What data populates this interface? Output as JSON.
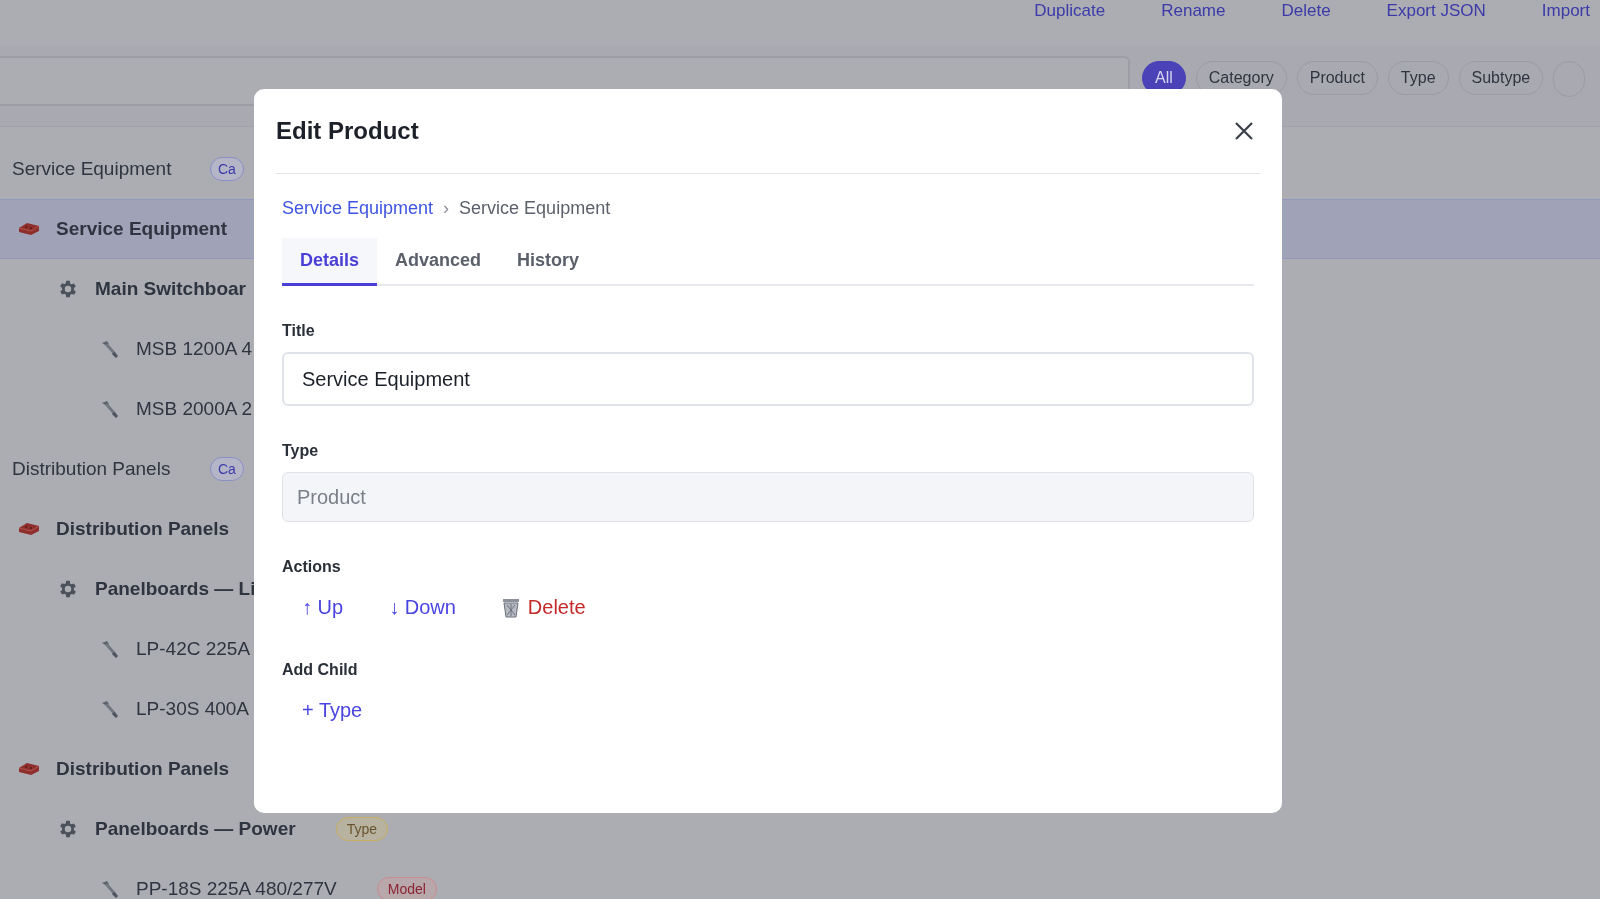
{
  "toolbar": {
    "actions": [
      "Duplicate",
      "Rename",
      "Delete",
      "Export JSON",
      "Import"
    ]
  },
  "filters": [
    {
      "label": "All",
      "selected": true
    },
    {
      "label": "Category",
      "selected": false
    },
    {
      "label": "Product",
      "selected": false
    },
    {
      "label": "Type",
      "selected": false
    },
    {
      "label": "Subtype",
      "selected": false
    }
  ],
  "tree": [
    {
      "title": "Service Equipment",
      "badge": {
        "label": "Ca",
        "kind": "category"
      },
      "items": [
        {
          "kind": "product",
          "label": "Service Equipment",
          "selected": true,
          "children": [
            {
              "kind": "type",
              "label": "Main Switchboar",
              "selected": false,
              "children": [
                {
                  "kind": "model",
                  "label": "MSB 1200A 4",
                  "selected": false
                },
                {
                  "kind": "model",
                  "label": "MSB 2000A 2",
                  "selected": false
                }
              ]
            }
          ]
        }
      ]
    },
    {
      "title": "Distribution Panels",
      "badge": {
        "label": "Ca",
        "kind": "category"
      },
      "items": [
        {
          "kind": "product",
          "label": "Distribution Panels",
          "selected": false,
          "children": [
            {
              "kind": "type",
              "label": "Panelboards — Li",
              "selected": false,
              "children": [
                {
                  "kind": "model",
                  "label": "LP-42C 225A",
                  "selected": false
                },
                {
                  "kind": "model",
                  "label": "LP-30S 400A",
                  "selected": false
                }
              ]
            }
          ]
        },
        {
          "kind": "product",
          "label": "Distribution Panels",
          "selected": false,
          "children": [
            {
              "kind": "type",
              "label": "Panelboards — Power",
              "selected": false,
              "badge": {
                "label": "Type",
                "kind": "type"
              },
              "children": [
                {
                  "kind": "model",
                  "label": "PP-18S 225A 480/277V",
                  "selected": false,
                  "badge": {
                    "label": "Model",
                    "kind": "model"
                  }
                }
              ]
            }
          ]
        }
      ]
    }
  ],
  "modal": {
    "title": "Edit Product",
    "breadcrumb": [
      {
        "label": "Service Equipment",
        "link": true
      },
      {
        "label": "›",
        "link": false
      },
      {
        "label": "Service Equipment",
        "link": false
      }
    ],
    "tabs": [
      {
        "label": "Details",
        "selected": true
      },
      {
        "label": "Advanced",
        "selected": false
      },
      {
        "label": "History",
        "selected": false
      }
    ],
    "fields": [
      {
        "label": "Title",
        "value": "Service Equipment",
        "disabled": false
      },
      {
        "label": "Type",
        "value": "Product",
        "disabled": true
      }
    ],
    "actions_label": "Actions",
    "actions": [
      {
        "kind": "move",
        "label": "↑ Up"
      },
      {
        "kind": "move",
        "label": "↓ Down"
      },
      {
        "kind": "danger",
        "label": "Delete"
      }
    ],
    "add_child_label": "Add Child",
    "add_child": [
      {
        "label": "+ Type"
      }
    ]
  }
}
